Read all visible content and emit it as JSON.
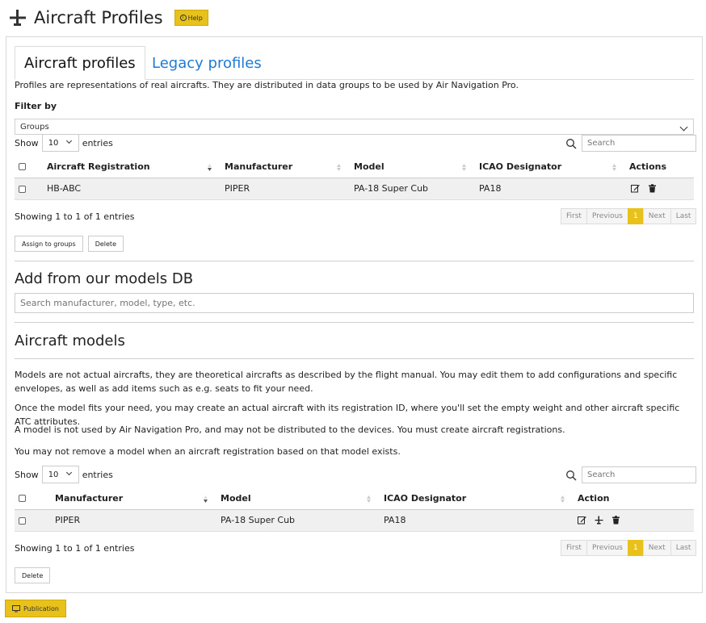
{
  "header": {
    "title": "Aircraft Profiles",
    "help_label": "Help"
  },
  "tabs": [
    {
      "label": "Aircraft profiles",
      "active": true
    },
    {
      "label": "Legacy profiles",
      "active": false
    }
  ],
  "profiles": {
    "intro": "Profiles are representations of real aircrafts. They are distributed in data groups to be used by Air Navigation Pro.",
    "filter_label": "Filter by",
    "filter_value": "Groups",
    "show_label": "Show",
    "entries_count": "10",
    "entries_label": "entries",
    "search_placeholder": "Search",
    "columns": [
      "Aircraft Registration",
      "Manufacturer",
      "Model",
      "ICAO Designator",
      "Actions"
    ],
    "rows": [
      {
        "registration": "HB-ABC",
        "manufacturer": "PIPER",
        "model": "PA-18 Super Cub",
        "icao": "PA18"
      }
    ],
    "info": "Showing 1 to 1 of 1 entries",
    "pager": [
      "First",
      "Previous",
      "1",
      "Next",
      "Last"
    ],
    "assign_button": "Assign to groups",
    "delete_button": "Delete"
  },
  "add_models": {
    "title": "Add from our models DB",
    "search_placeholder": "Search manufacturer, model, type, etc."
  },
  "models": {
    "title": "Aircraft models",
    "para1": "Models are not actual aircrafts, they are theoretical aircrafts as described by the flight manual. You may edit them to add configurations and specific envelopes, as well as add items such as e.g. seats to fit your need.",
    "para2": "Once the model fits your need, you may create an actual aircraft with its registration ID, where you'll set the empty weight and other aircraft specific ATC attributes.",
    "para3": "A model is not used by Air Navigation Pro, and may not be distributed to the devices. You must create aircraft registrations.",
    "para4": "You may not remove a model when an aircraft registration based on that model exists.",
    "show_label": "Show",
    "entries_count": "10",
    "entries_label": "entries",
    "search_placeholder": "Search",
    "columns": [
      "Manufacturer",
      "Model",
      "ICAO Designator",
      "Action"
    ],
    "rows": [
      {
        "manufacturer": "PIPER",
        "model": "PA-18 Super Cub",
        "icao": "PA18"
      }
    ],
    "info": "Showing 1 to 1 of 1 entries",
    "pager": [
      "First",
      "Previous",
      "1",
      "Next",
      "Last"
    ],
    "delete_button": "Delete"
  },
  "publication_button": "Publication",
  "colors": {
    "accent": "#e8c21a",
    "link": "#1e7ad6",
    "row_bg": "#f0f0f0"
  }
}
